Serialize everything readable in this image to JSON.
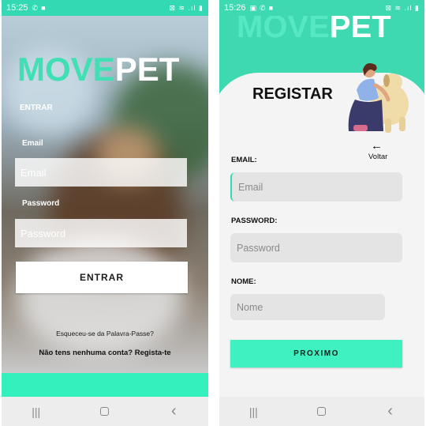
{
  "login": {
    "status": {
      "time": "15:25",
      "indicators": "⊠ ≋ .ıl ▮"
    },
    "logo_a": "MOVE",
    "logo_b": "PET",
    "title": "ENTRAR",
    "email_label": "Email",
    "email_placeholder": "Email",
    "password_label": "Password",
    "password_placeholder": "Password",
    "enter_button": "ENTRAR",
    "forgot_link": "Esqueceu-se da Palavra-Passe?",
    "signup_link": "Não tens nenhuma conta? Regista-te"
  },
  "register": {
    "status": {
      "time": "15:26",
      "indicators": "⊠ ≋ .ıl ▮"
    },
    "logo_a": "MOVE",
    "logo_b": "PET",
    "title": "REGISTAR",
    "back_label": "Voltar",
    "email_label": "EMAIL:",
    "email_placeholder": "Email",
    "password_label": "PASSWORD:",
    "password_placeholder": "Password",
    "name_label": "NOME:",
    "name_placeholder": "Nome",
    "next_button": "PROXIMO"
  },
  "nav": {
    "recents": "|||",
    "home": "",
    "back": "‹"
  },
  "colors": {
    "accent": "#3ff1c0",
    "status_bar": "#33d9b2",
    "field_bg": "#e4e4e4"
  }
}
